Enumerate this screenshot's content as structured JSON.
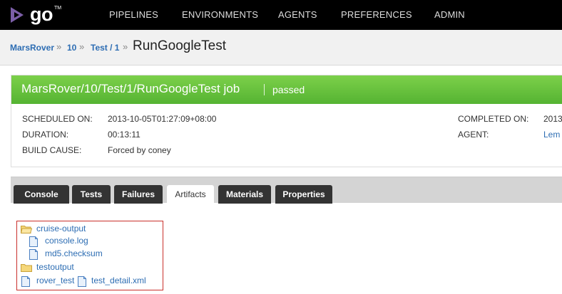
{
  "app": {
    "logo_text": "go",
    "logo_tm": "TM"
  },
  "nav": {
    "items": [
      "PIPELINES",
      "ENVIRONMENTS",
      "AGENTS",
      "PREFERENCES",
      "ADMIN"
    ]
  },
  "breadcrumb": {
    "pipeline": "MarsRover",
    "counter": "10",
    "stage": "Test / 1",
    "job": "RunGoogleTest",
    "separator": "»"
  },
  "job": {
    "title": "MarsRover/10/Test/1/RunGoogleTest job",
    "status": "passed",
    "status_color": "#5fbb3a",
    "scheduled_on_label": "SCHEDULED ON:",
    "scheduled_on": "2013-10-05T01:27:09+08:00",
    "duration_label": "DURATION:",
    "duration": "00:13:11",
    "build_cause_label": "BUILD CAUSE:",
    "build_cause": "Forced by coney",
    "completed_on_label": "COMPLETED ON:",
    "completed_on": "2013",
    "agent_label": "AGENT:",
    "agent": "Lem"
  },
  "tabs": [
    "Console",
    "Tests",
    "Failures",
    "Artifacts",
    "Materials",
    "Properties"
  ],
  "active_tab": "Artifacts",
  "artifacts": {
    "cruise_output": "cruise-output",
    "console_log": "console.log",
    "md5_checksum": "md5.checksum",
    "testoutput": "testoutput",
    "rover_test": "rover_test",
    "test_detail": "test_detail.xml"
  },
  "icons": {
    "folder": "folder-icon",
    "folder_open": "folder-open-icon",
    "file": "file-icon"
  }
}
